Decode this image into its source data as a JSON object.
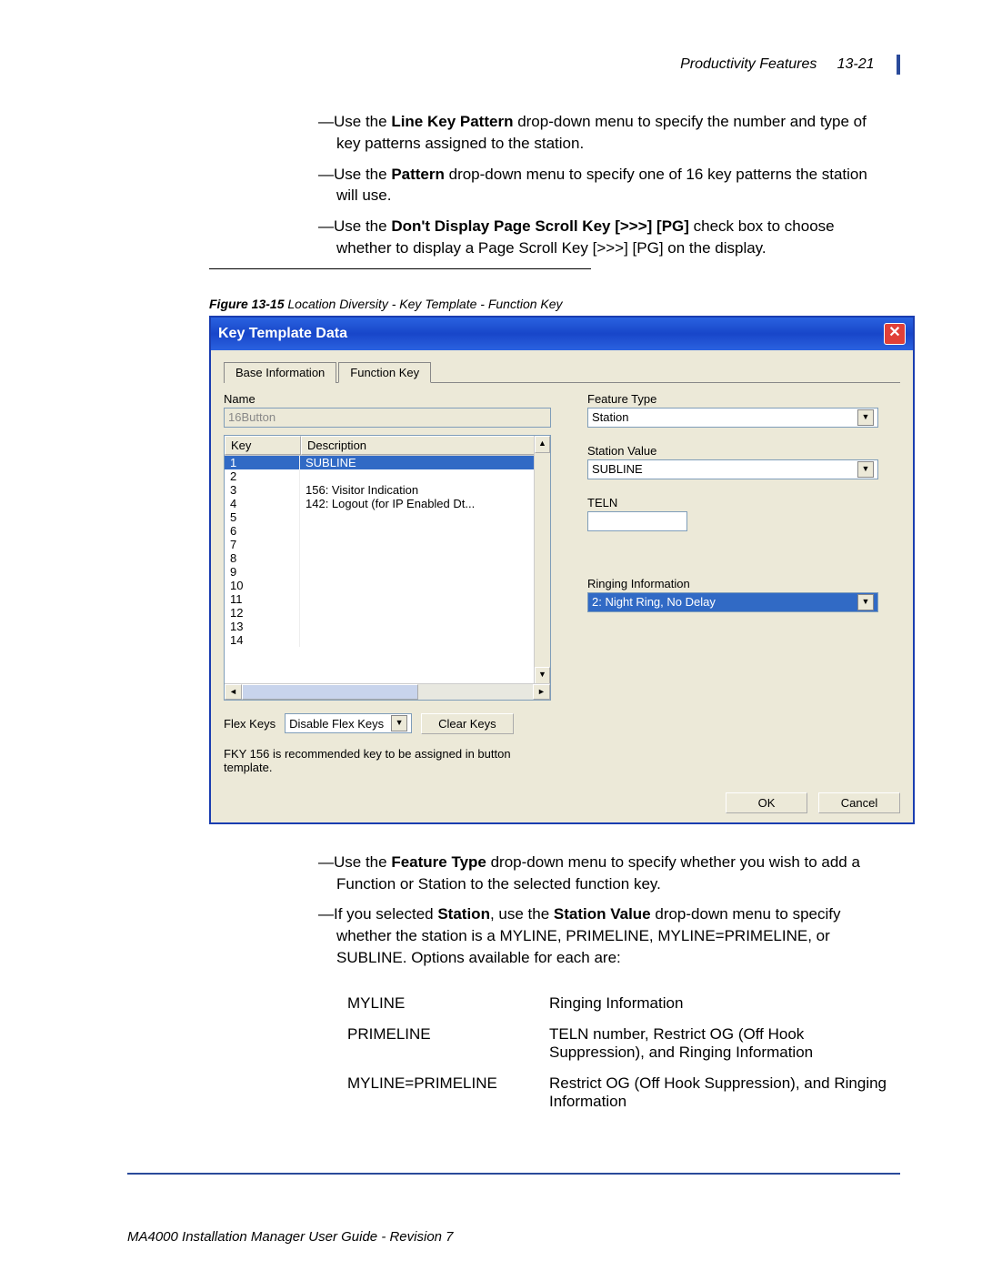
{
  "header": {
    "section": "Productivity Features",
    "page": "13-21"
  },
  "bullets_top": [
    {
      "pre": "—Use the ",
      "b": "Line Key Pattern",
      "post": " drop-down menu to specify the number and type of key patterns assigned to the station."
    },
    {
      "pre": "—Use the ",
      "b": "Pattern",
      "post": " drop-down menu to specify one of 16 key patterns the station will use."
    },
    {
      "pre": "—Use the ",
      "b": "Don't Display Page Scroll Key [>>>] [PG]",
      "post": " check box to choose whether to display a Page Scroll Key [>>>] [PG] on the display."
    }
  ],
  "figure": {
    "num": "Figure 13-15",
    "title": "Location Diversity - Key Template - Function Key"
  },
  "dialog": {
    "title": "Key Template Data",
    "tabs": [
      "Base Information",
      "Function Key"
    ],
    "active_tab": 1,
    "name_label": "Name",
    "name_value": "16Button",
    "key_header": "Key",
    "desc_header": "Description",
    "rows": [
      {
        "key": "1",
        "desc": "SUBLINE"
      },
      {
        "key": "2",
        "desc": ""
      },
      {
        "key": "3",
        "desc": "156: Visitor Indication"
      },
      {
        "key": "4",
        "desc": "142: Logout (for IP Enabled Dt..."
      },
      {
        "key": "5",
        "desc": ""
      },
      {
        "key": "6",
        "desc": ""
      },
      {
        "key": "7",
        "desc": ""
      },
      {
        "key": "8",
        "desc": ""
      },
      {
        "key": "9",
        "desc": ""
      },
      {
        "key": "10",
        "desc": ""
      },
      {
        "key": "11",
        "desc": ""
      },
      {
        "key": "12",
        "desc": ""
      },
      {
        "key": "13",
        "desc": ""
      },
      {
        "key": "14",
        "desc": ""
      }
    ],
    "feature_type_label": "Feature Type",
    "feature_type_value": "Station",
    "station_value_label": "Station Value",
    "station_value_value": "SUBLINE",
    "teln_label": "TELN",
    "teln_value": "",
    "ringing_label": "Ringing Information",
    "ringing_value": "2: Night Ring, No Delay",
    "flexkeys_label": "Flex Keys",
    "flexkeys_value": "Disable Flex Keys",
    "clearkeys": "Clear Keys",
    "note": "FKY 156 is recommended key to be assigned in button template.",
    "ok": "OK",
    "cancel": "Cancel"
  },
  "bullets_bottom": [
    {
      "pre": "—Use the ",
      "b": "Feature Type",
      "post": " drop-down menu to specify whether you wish to add a Function or Station to the selected function key."
    },
    {
      "pre": "—If you selected ",
      "b": "Station",
      "mid": ", use the ",
      "b2": "Station Value",
      "post": " drop-down menu to specify whether the station is a MYLINE, PRIMELINE, MYLINE=PRIMELINE, or SUBLINE. Options available for each are:"
    }
  ],
  "options": [
    {
      "k": "MYLINE",
      "v": "Ringing Information"
    },
    {
      "k": "PRIMELINE",
      "v": "TELN number, Restrict OG (Off Hook Suppression), and Ringing Information"
    },
    {
      "k": "MYLINE=PRIMELINE",
      "v": "Restrict OG (Off Hook Suppression), and Ringing Information"
    }
  ],
  "footer": "MA4000 Installation Manager User Guide - Revision 7"
}
